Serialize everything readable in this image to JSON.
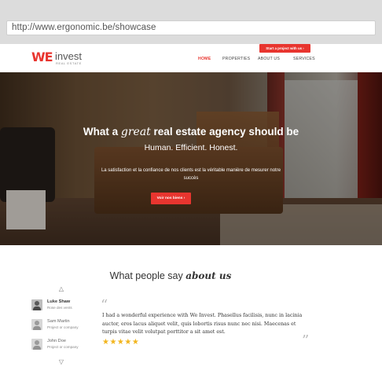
{
  "browser": {
    "url": "http://www.ergonomic.be/showcase"
  },
  "header": {
    "logo_we": "WE",
    "logo_invest": "invest",
    "logo_sub": "REAL ESTATE",
    "cta": "Start a project with us  ›",
    "nav": [
      "HOME",
      "PROPERTIES",
      "ABOUT US",
      "SERVICES"
    ]
  },
  "hero": {
    "title_pre": "What a ",
    "title_em": "great",
    "title_post": " real estate agency should be",
    "subtitle": "Human. Efficient. Honest.",
    "description": "La satisfaction et la confiance de nos clients est la véritable manière de mesurer notre succès",
    "button": "Voir nos biens  ›"
  },
  "testimonials": {
    "title_pre": "What people say ",
    "title_em": "about us",
    "people": [
      {
        "name": "Luke Shaw",
        "role": "Rose des vents"
      },
      {
        "name": "Sam Martin",
        "role": "Project or company"
      },
      {
        "name": "John Doe",
        "role": "Project or company"
      }
    ],
    "quote": "I had a wonderful experience with We Invest. Phasellus facilisis, nunc in lacinia auctor, eros lacus aliquet velit, quis lobortis risus nunc nec nisi. Maecenas et turpis vitae velit volutpat porttitor a sit amet est.",
    "rating": 5,
    "stars": "★★★★★"
  },
  "colors": {
    "accent": "#e8352f",
    "star": "#f2b51d"
  }
}
